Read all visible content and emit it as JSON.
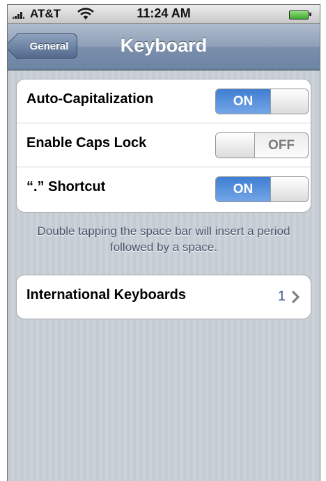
{
  "status_bar": {
    "carrier": "AT&T",
    "time": "11:24 AM"
  },
  "nav_bar": {
    "back_label": "General",
    "title": "Keyboard"
  },
  "settings": [
    {
      "label": "Auto-Capitalization",
      "state": "ON"
    },
    {
      "label": "Enable Caps Lock",
      "state": "OFF"
    },
    {
      "label": "“.” Shortcut",
      "state": "ON"
    }
  ],
  "footer_note": "Double tapping the space bar will insert a period followed by a space.",
  "international": {
    "label": "International Keyboards",
    "value": "1"
  },
  "colors": {
    "toggle_on": "#3f7ed2",
    "nav_bar": "#6d84a3",
    "value_text": "#385487"
  }
}
